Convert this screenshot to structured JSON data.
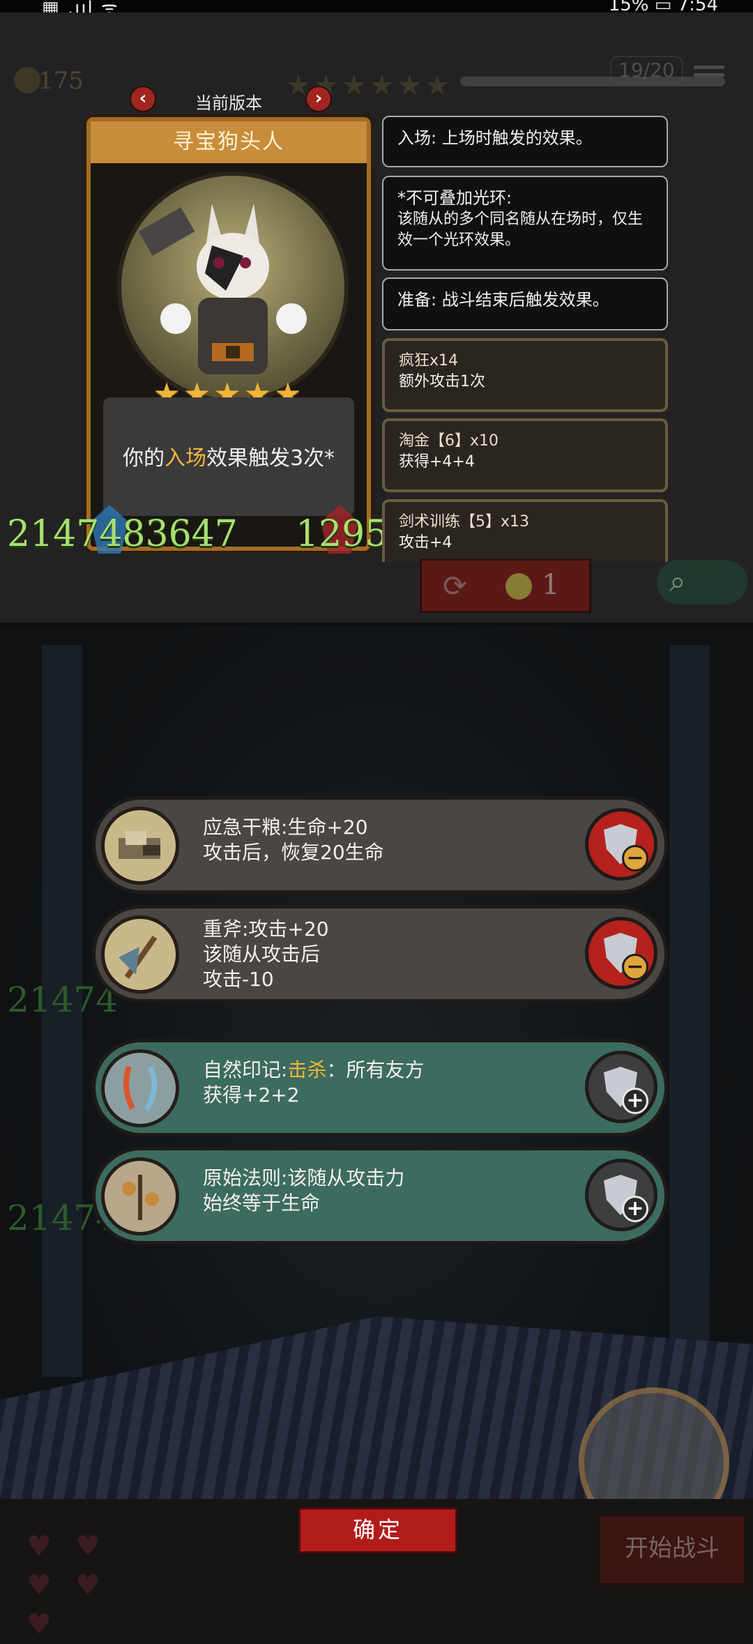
{
  "status_bar": {
    "left": "▦ .ııl ᯤ",
    "right": "15% ▭ 7:54"
  },
  "header": {
    "coins": "175",
    "stars": "★★★★★★",
    "page_counter": "19/20",
    "version_label": "当前版本"
  },
  "card": {
    "name": "寻宝狗头人",
    "stars": "★★★★★",
    "desc_prefix": "你的",
    "desc_highlight": "入场",
    "desc_suffix": "效果触发3次*",
    "attack": "2147483647",
    "health": "1295"
  },
  "tooltips": [
    {
      "title": "入场: 上场时触发的效果。"
    },
    {
      "title": "*不可叠加光环:",
      "sub": "该随从的多个同名随从在场时，仅生效一个光环效果。"
    },
    {
      "title": "准备: 战斗结束后触发效果。"
    },
    {
      "title": "疯狂x14",
      "sub": "额外攻击1次"
    },
    {
      "title": "淘金【6】x10",
      "sub": "获得+4+4"
    },
    {
      "title": "剑术训练【5】x13",
      "sub": "攻击+4"
    }
  ],
  "refresh": {
    "cost": "1"
  },
  "background": {
    "number_1": "21474",
    "number_2": "21474"
  },
  "items": [
    {
      "line1": "应急干粮:生命+20",
      "line2": "攻击后，恢复20生命",
      "line3": "",
      "action": "remove"
    },
    {
      "line1": "重斧:攻击+20",
      "line2": "该随从攻击后",
      "line3": "攻击-10",
      "action": "remove"
    },
    {
      "line1_prefix": "自然印记:",
      "line1_highlight": "击杀",
      "line1_suffix": "：所有友方",
      "line2": "获得+2+2",
      "action": "add"
    },
    {
      "line1": "原始法则:该随从攻击力",
      "line2": "始终等于生命",
      "action": "add"
    }
  ],
  "footer": {
    "confirm": "确定",
    "start_battle": "开始战斗"
  },
  "colors": {
    "highlight": "#f2b83b",
    "stat_green": "#a8e06f",
    "confirm_red": "#b11c1a",
    "item_teal": "#3c6b5f"
  }
}
